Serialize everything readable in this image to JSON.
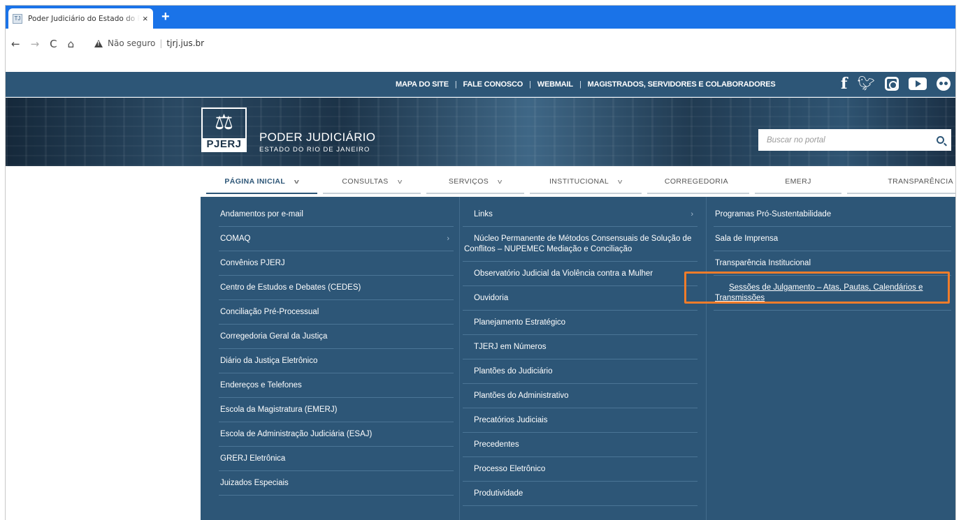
{
  "browser": {
    "tab_title": "Poder Judiciário do Estado do Rio de Janeiro",
    "tab_close": "×",
    "new_tab": "+",
    "security_label": "Não seguro",
    "url": "tjrj.jus.br",
    "favicon_text": "TJ"
  },
  "header": {
    "top_links": [
      "MAPA DO SITE",
      "FALE CONOSCO",
      "WEBMAIL",
      "MAGISTRADOS, SERVIDORES E COLABORADORES"
    ],
    "social": [
      "facebook-icon",
      "twitter-icon",
      "instagram-icon",
      "youtube-icon",
      "flickr-icon"
    ],
    "logo_text": "PJERJ",
    "brand_title": "PODER JUDICIÁRIO",
    "brand_subtitle": "ESTADO DO RIO DE JANEIRO",
    "search_placeholder": "Buscar no portal"
  },
  "nav": {
    "items": [
      {
        "label": "PÁGINA INICIAL",
        "has_chevron": true,
        "active": true
      },
      {
        "label": "CONSULTAS",
        "has_chevron": true
      },
      {
        "label": "SERVIÇOS",
        "has_chevron": true
      },
      {
        "label": "INSTITUCIONAL",
        "has_chevron": true
      },
      {
        "label": "CORREGEDORIA"
      },
      {
        "label": "EMERJ"
      },
      {
        "label": "TRANSPARÊNCIA"
      }
    ]
  },
  "dropdown": {
    "col1": [
      "Andamentos por e-mail",
      "COMAQ",
      "Convênios PJERJ",
      "Centro de Estudos e Debates (CEDES)",
      "Conciliação Pré-Processual",
      "Corregedoria Geral da Justiça",
      "Diário da Justiça Eletrônico",
      "Endereços e Telefones",
      "Escola da Magistratura (EMERJ)",
      "Escola de Administração Judiciária (ESAJ)",
      "GRERJ Eletrônica",
      "Juizados Especiais"
    ],
    "col2": [
      "Links",
      "Núcleo Permanente de Métodos Consensuais de Solução de Conflitos – NUPEMEC Mediação e Conciliação",
      "Observatório Judicial da Violência contra a Mulher",
      "Ouvidoria",
      "Planejamento Estratégico",
      "TJERJ em Números",
      "Plantões do Judiciário",
      "Plantões do Administrativo",
      "Precatórios Judiciais",
      "Precedentes",
      "Processo Eletrônico",
      "Produtividade"
    ],
    "col3": [
      "Programas Pró-Sustentabilidade",
      "Sala de Imprensa",
      "Transparência Institucional",
      "Sessões de Julgamento – Atas, Pautas, Calendários e Transmissões"
    ]
  },
  "colors": {
    "brand": "#2d5677",
    "highlight": "#f07c2a",
    "chrome": "#1a73e8"
  }
}
